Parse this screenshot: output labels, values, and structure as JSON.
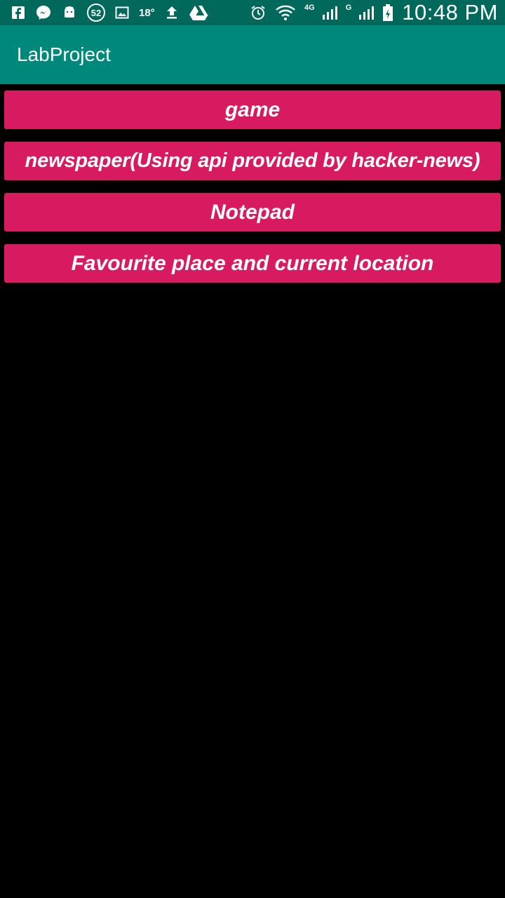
{
  "status_bar": {
    "notification_count": "52",
    "temperature": "18°",
    "network_primary": "4G",
    "network_secondary": "G",
    "time": "10:48 PM",
    "icons": [
      "facebook-icon",
      "messenger-icon",
      "android-icon",
      "notification-count-badge",
      "image-icon",
      "upload-icon",
      "drive-icon",
      "alarm-icon",
      "wifi-icon",
      "signal-icon",
      "battery-icon"
    ]
  },
  "app_bar": {
    "title": "LabProject"
  },
  "menu": {
    "buttons": [
      {
        "label": "game"
      },
      {
        "label": "newspaper(Using api provided by hacker-news)"
      },
      {
        "label": "Notepad"
      },
      {
        "label": "Favourite place and current location"
      }
    ]
  },
  "colors": {
    "status_bar": "#00695c",
    "app_bar": "#00897b",
    "button": "#d81b60",
    "background": "#000000"
  }
}
